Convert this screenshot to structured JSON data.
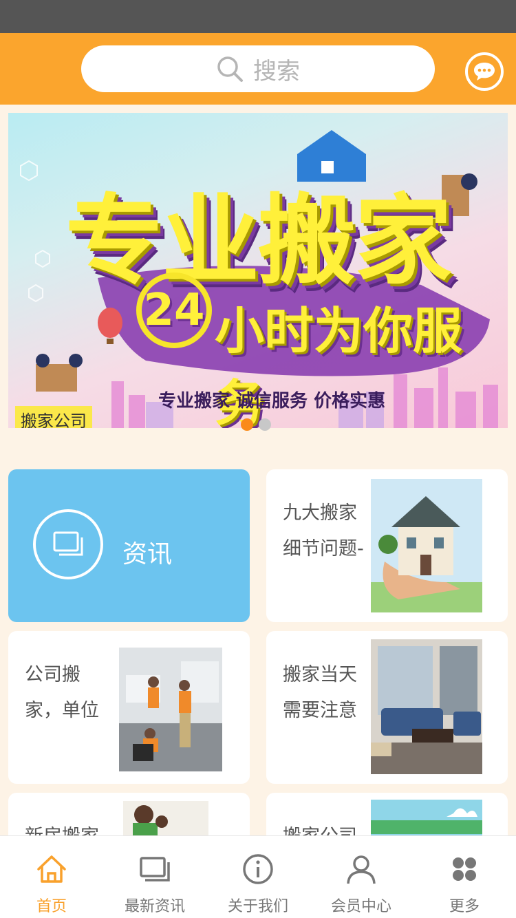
{
  "header": {
    "search_placeholder": "搜索"
  },
  "banner": {
    "title": "专业搬家",
    "hours": "24",
    "subtitle": "小时为你服务",
    "slogan": "专业搬家 诚信服务 价格实惠",
    "company_tag": "搬家公司",
    "slide_count": 2,
    "active_slide": 1
  },
  "feature": {
    "label": "资讯"
  },
  "articles": [
    {
      "text": "九大搬家细节问题-"
    },
    {
      "text": "公司搬家，单位"
    },
    {
      "text": "搬家当天需要注意"
    },
    {
      "text": "新房搬家"
    },
    {
      "text": "搬家公司"
    }
  ],
  "tabbar": {
    "items": [
      {
        "label": "首页",
        "icon": "home-icon",
        "active": true
      },
      {
        "label": "最新资讯",
        "icon": "news-icon",
        "active": false
      },
      {
        "label": "关于我们",
        "icon": "info-icon",
        "active": false
      },
      {
        "label": "会员中心",
        "icon": "user-icon",
        "active": false
      },
      {
        "label": "更多",
        "icon": "grid-icon",
        "active": false
      }
    ]
  },
  "colors": {
    "header": "#fba52d",
    "accent": "#f9a12c",
    "feature_card": "#6cc4ef",
    "background": "#fdf3e6"
  }
}
